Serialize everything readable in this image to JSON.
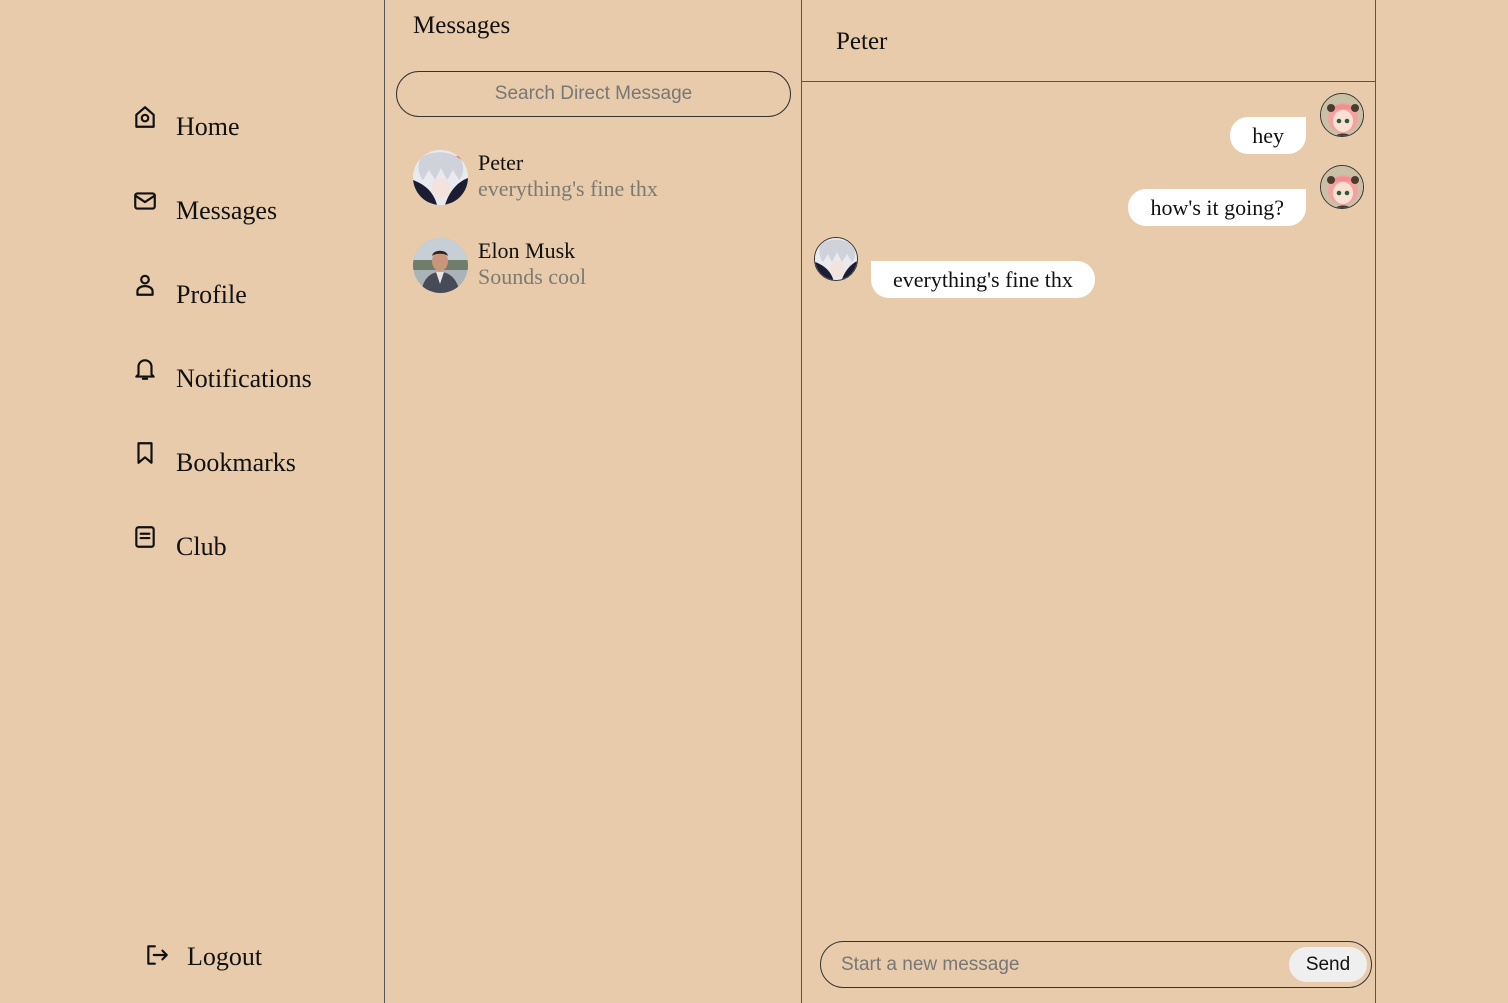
{
  "nav": {
    "items": [
      {
        "label": "Home",
        "icon": "home-icon"
      },
      {
        "label": "Messages",
        "icon": "mail-icon"
      },
      {
        "label": "Profile",
        "icon": "user-icon"
      },
      {
        "label": "Notifications",
        "icon": "bell-icon"
      },
      {
        "label": "Bookmarks",
        "icon": "bookmark-icon"
      },
      {
        "label": "Club",
        "icon": "document-icon"
      }
    ],
    "logout_label": "Logout"
  },
  "conversations": {
    "title": "Messages",
    "search_placeholder": "Search Direct Message",
    "items": [
      {
        "name": "Peter",
        "preview": "everything's fine thx",
        "avatar": "white-haired-anime-avatar"
      },
      {
        "name": "Elon Musk",
        "preview": "Sounds cool",
        "avatar": "man-in-suit-photo-avatar"
      }
    ]
  },
  "chat": {
    "contact_name": "Peter",
    "messages": [
      {
        "text": "hey",
        "direction": "outgoing"
      },
      {
        "text": "how's it going?",
        "direction": "outgoing"
      },
      {
        "text": "everything's fine thx",
        "direction": "incoming"
      }
    ],
    "composer_placeholder": "Start a new message",
    "send_label": "Send"
  },
  "colors": {
    "background": "#e8cbab",
    "bubble": "#ffffff",
    "border": "#555555",
    "muted_text": "#7d7a74"
  }
}
